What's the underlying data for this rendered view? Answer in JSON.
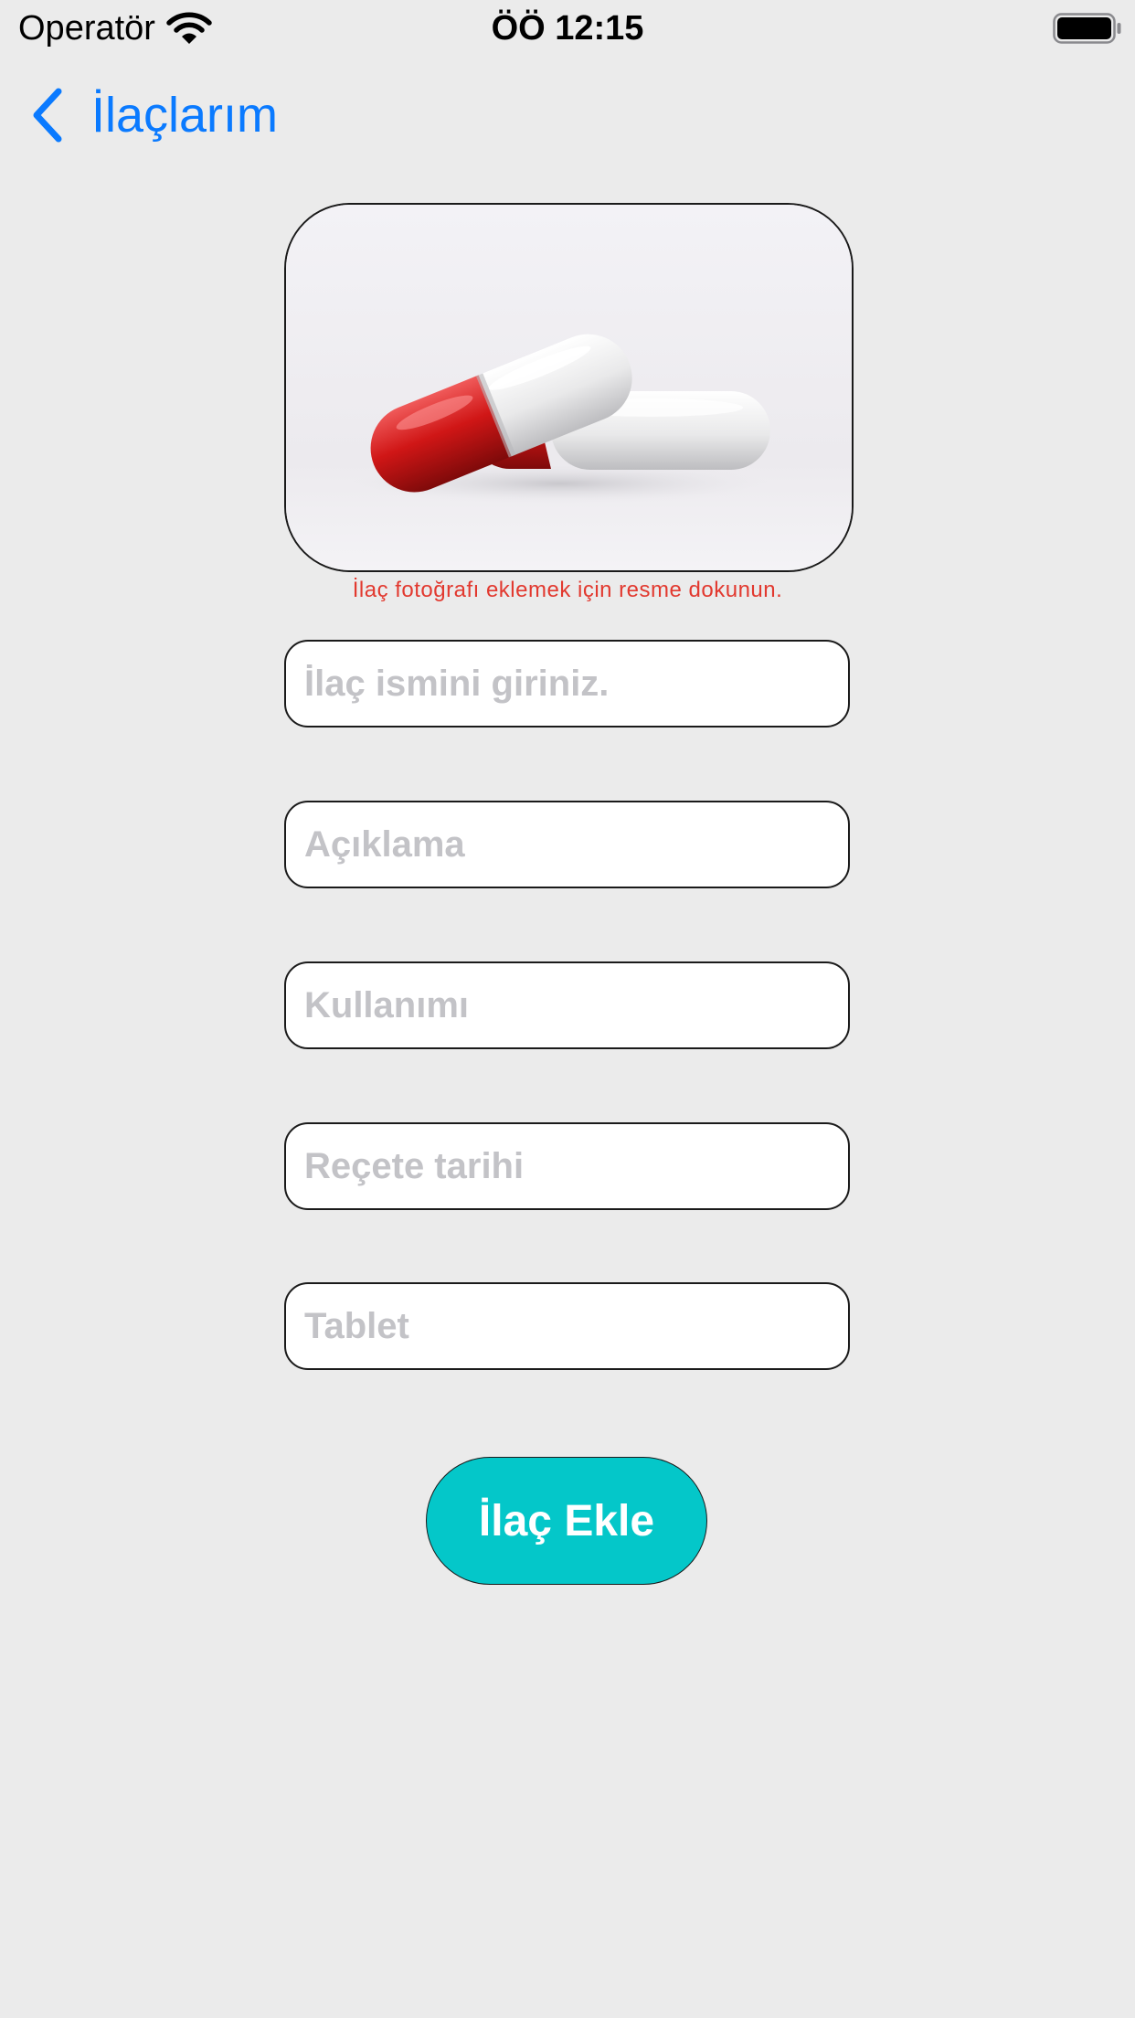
{
  "status_bar": {
    "carrier": "Operatör",
    "time": "ÖÖ 12:15",
    "wifi_icon": "wifi-icon",
    "battery_icon": "battery-icon",
    "battery_level": 1.0
  },
  "nav": {
    "back_label": "İlaçlarım",
    "back_icon": "chevron-left-icon",
    "accent_color": "#0a7aff"
  },
  "photo": {
    "hint": "İlaç fotoğrafı eklemek için resme dokunun.",
    "hint_color": "#e2392f",
    "subject": "red-white-capsules"
  },
  "form": {
    "fields": [
      {
        "name": "name",
        "placeholder": "İlaç ismini giriniz.",
        "value": ""
      },
      {
        "name": "description",
        "placeholder": "Açıklama",
        "value": ""
      },
      {
        "name": "usage",
        "placeholder": "Kullanımı",
        "value": ""
      },
      {
        "name": "prescription_date",
        "placeholder": "Reçete tarihi",
        "value": ""
      },
      {
        "name": "tablet",
        "placeholder": "Tablet",
        "value": ""
      }
    ]
  },
  "actions": {
    "add_label": "İlaç Ekle",
    "add_color": "#04c7c9"
  },
  "colors": {
    "background": "#ebebeb"
  }
}
